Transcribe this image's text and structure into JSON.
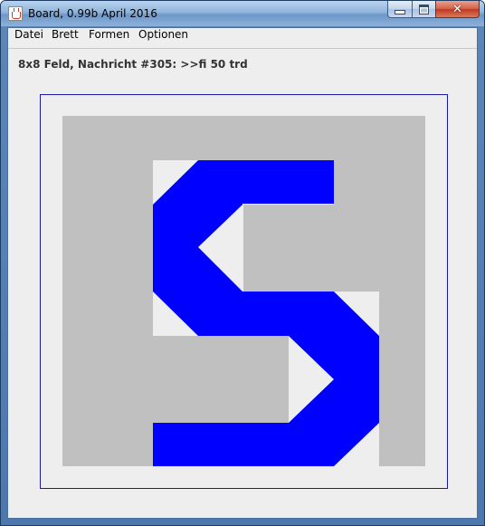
{
  "window": {
    "title": "Board, 0.99b April 2016",
    "controls": {
      "minimize": "minimize",
      "maximize": "maximize",
      "close": "close"
    }
  },
  "menu": {
    "items": [
      {
        "label": "Datei"
      },
      {
        "label": "Brett"
      },
      {
        "label": "Formen"
      },
      {
        "label": "Optionen"
      }
    ]
  },
  "status": {
    "text": "8x8 Feld, Nachricht #305: >>fi 50 trd"
  },
  "board": {
    "grid": "8x8",
    "colors": {
      "background": "#eeeeee",
      "gray": "#c0c0c0",
      "blue": "#0000ff",
      "frame": "#1a1aa6"
    },
    "glyph": "S"
  }
}
